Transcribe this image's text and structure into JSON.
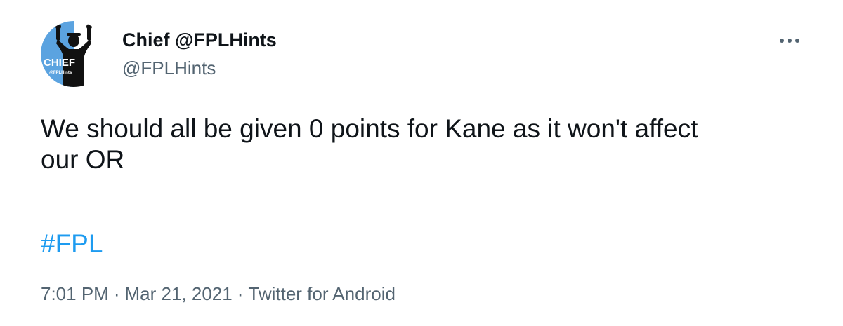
{
  "author": {
    "display_name": "Chief @FPLHints",
    "handle": "@FPLHints",
    "avatar": {
      "icon": "avatar-icon",
      "text": "CHIEF",
      "subtext": "@FPLHints",
      "colors": {
        "left": "#5ba3e0",
        "right": "#ffffff",
        "figure": "#111111"
      }
    }
  },
  "more_icon": "more-horizontal-icon",
  "tweet": {
    "lines": [
      "We should all be given 0 points for Kane as it won't affect",
      "our OR"
    ],
    "hashtag": "#FPL"
  },
  "meta": {
    "time": "7:01 PM",
    "separator": "·",
    "date": "Mar 21, 2021",
    "source": "Twitter for Android"
  },
  "colors": {
    "text": "#0f1419",
    "secondary": "#536471",
    "link": "#1d9bf0"
  }
}
